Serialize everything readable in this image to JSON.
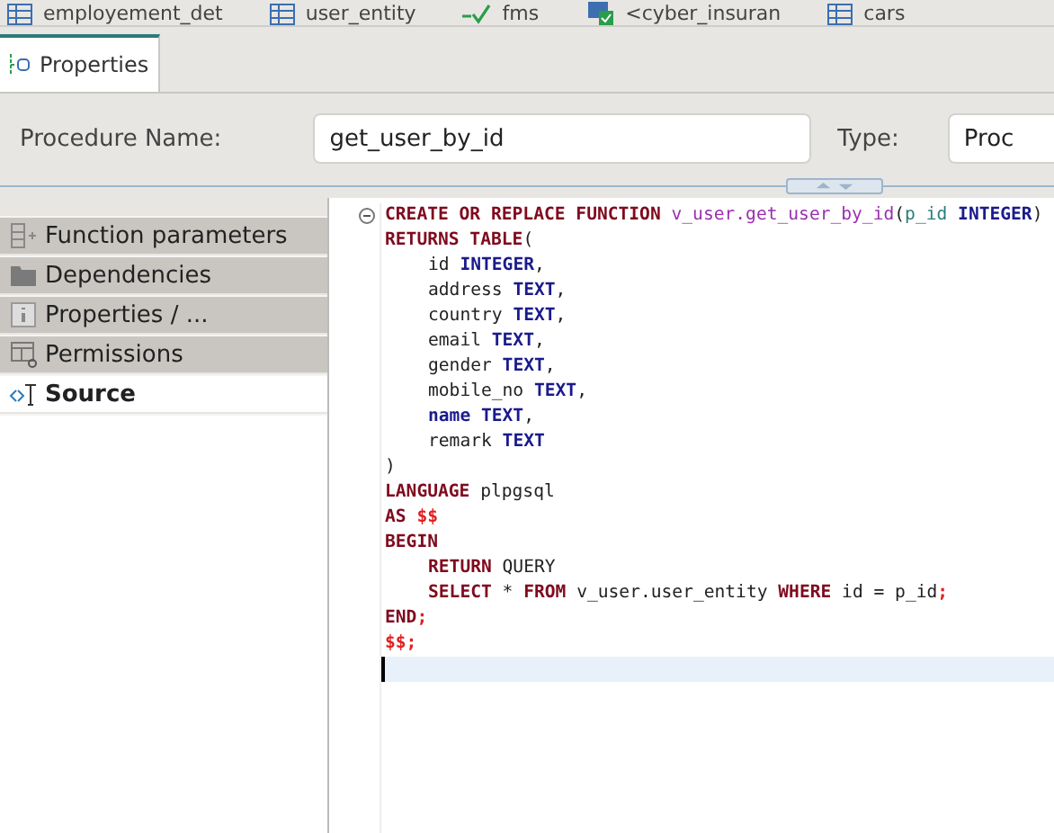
{
  "editor_tabs": [
    {
      "label": "employement_det"
    },
    {
      "label": "user_entity"
    },
    {
      "label": "fms"
    },
    {
      "label": "<cyber_insuran"
    },
    {
      "label": "cars"
    }
  ],
  "view_tab": {
    "label": "Properties",
    "selected": true
  },
  "form": {
    "name_label": "Procedure Name:",
    "name_value": "get_user_by_id",
    "type_label": "Type:",
    "type_value": "Proc"
  },
  "nav_items": [
    {
      "label": "Function parameters",
      "selected": false
    },
    {
      "label": "Dependencies",
      "selected": false
    },
    {
      "label": "Properties / ...",
      "selected": false
    },
    {
      "label": "Permissions",
      "selected": false
    },
    {
      "label": "Source",
      "selected": true
    }
  ],
  "code_lines": [
    {
      "fold": true,
      "current": false,
      "indent": false,
      "tokens": [
        {
          "kind": "keyword",
          "text": "CREATE OR REPLACE FUNCTION "
        },
        {
          "kind": "function",
          "text": "v_user.get_user_by_id"
        },
        {
          "kind": "plain",
          "text": "("
        },
        {
          "kind": "param",
          "text": "p_id "
        },
        {
          "kind": "type",
          "text": "INTEGER"
        },
        {
          "kind": "plain",
          "text": ")"
        }
      ]
    },
    {
      "fold": false,
      "current": false,
      "indent": false,
      "tokens": [
        {
          "kind": "keyword",
          "text": "RETURNS TABLE"
        },
        {
          "kind": "plain",
          "text": "("
        }
      ]
    },
    {
      "fold": false,
      "current": false,
      "indent": true,
      "tokens": [
        {
          "kind": "plain",
          "text": "id "
        },
        {
          "kind": "type",
          "text": "INTEGER"
        },
        {
          "kind": "plain",
          "text": ","
        }
      ]
    },
    {
      "fold": false,
      "current": false,
      "indent": true,
      "tokens": [
        {
          "kind": "plain",
          "text": "address "
        },
        {
          "kind": "type",
          "text": "TEXT"
        },
        {
          "kind": "plain",
          "text": ","
        }
      ]
    },
    {
      "fold": false,
      "current": false,
      "indent": true,
      "tokens": [
        {
          "kind": "plain",
          "text": "country "
        },
        {
          "kind": "type",
          "text": "TEXT"
        },
        {
          "kind": "plain",
          "text": ","
        }
      ]
    },
    {
      "fold": false,
      "current": false,
      "indent": true,
      "tokens": [
        {
          "kind": "plain",
          "text": "email "
        },
        {
          "kind": "type",
          "text": "TEXT"
        },
        {
          "kind": "plain",
          "text": ","
        }
      ]
    },
    {
      "fold": false,
      "current": false,
      "indent": true,
      "tokens": [
        {
          "kind": "plain",
          "text": "gender "
        },
        {
          "kind": "type",
          "text": "TEXT"
        },
        {
          "kind": "plain",
          "text": ","
        }
      ]
    },
    {
      "fold": false,
      "current": false,
      "indent": true,
      "tokens": [
        {
          "kind": "plain",
          "text": "mobile_no "
        },
        {
          "kind": "type",
          "text": "TEXT"
        },
        {
          "kind": "plain",
          "text": ","
        }
      ]
    },
    {
      "fold": false,
      "current": false,
      "indent": true,
      "tokens": [
        {
          "kind": "type",
          "text": "name TEXT"
        },
        {
          "kind": "plain",
          "text": ","
        }
      ]
    },
    {
      "fold": false,
      "current": false,
      "indent": true,
      "tokens": [
        {
          "kind": "plain",
          "text": "remark "
        },
        {
          "kind": "type",
          "text": "TEXT"
        }
      ]
    },
    {
      "fold": false,
      "current": false,
      "indent": false,
      "tokens": [
        {
          "kind": "plain",
          "text": ")"
        }
      ]
    },
    {
      "fold": false,
      "current": false,
      "indent": false,
      "tokens": [
        {
          "kind": "keyword",
          "text": "LANGUAGE"
        },
        {
          "kind": "plain",
          "text": " plpgsql"
        }
      ]
    },
    {
      "fold": false,
      "current": false,
      "indent": false,
      "tokens": [
        {
          "kind": "keyword",
          "text": "AS "
        },
        {
          "kind": "dollar",
          "text": "$$"
        }
      ]
    },
    {
      "fold": false,
      "current": false,
      "indent": false,
      "tokens": [
        {
          "kind": "keyword",
          "text": "BEGIN"
        }
      ]
    },
    {
      "fold": false,
      "current": false,
      "indent": true,
      "tokens": [
        {
          "kind": "keyword",
          "text": "RETURN"
        },
        {
          "kind": "plain",
          "text": " QUERY"
        }
      ]
    },
    {
      "fold": false,
      "current": false,
      "indent": true,
      "tokens": [
        {
          "kind": "keyword",
          "text": "SELECT"
        },
        {
          "kind": "plain",
          "text": " * "
        },
        {
          "kind": "keyword",
          "text": "FROM"
        },
        {
          "kind": "plain",
          "text": " v_user.user_entity "
        },
        {
          "kind": "keyword",
          "text": "WHERE"
        },
        {
          "kind": "plain",
          "text": " id = p_id"
        },
        {
          "kind": "dollar",
          "text": ";"
        }
      ]
    },
    {
      "fold": false,
      "current": false,
      "indent": false,
      "tokens": [
        {
          "kind": "keyword",
          "text": "END"
        },
        {
          "kind": "dollar",
          "text": ";"
        }
      ]
    },
    {
      "fold": false,
      "current": false,
      "indent": false,
      "tokens": [
        {
          "kind": "dollar",
          "text": "$$;"
        }
      ]
    },
    {
      "fold": false,
      "current": true,
      "indent": false
    }
  ]
}
